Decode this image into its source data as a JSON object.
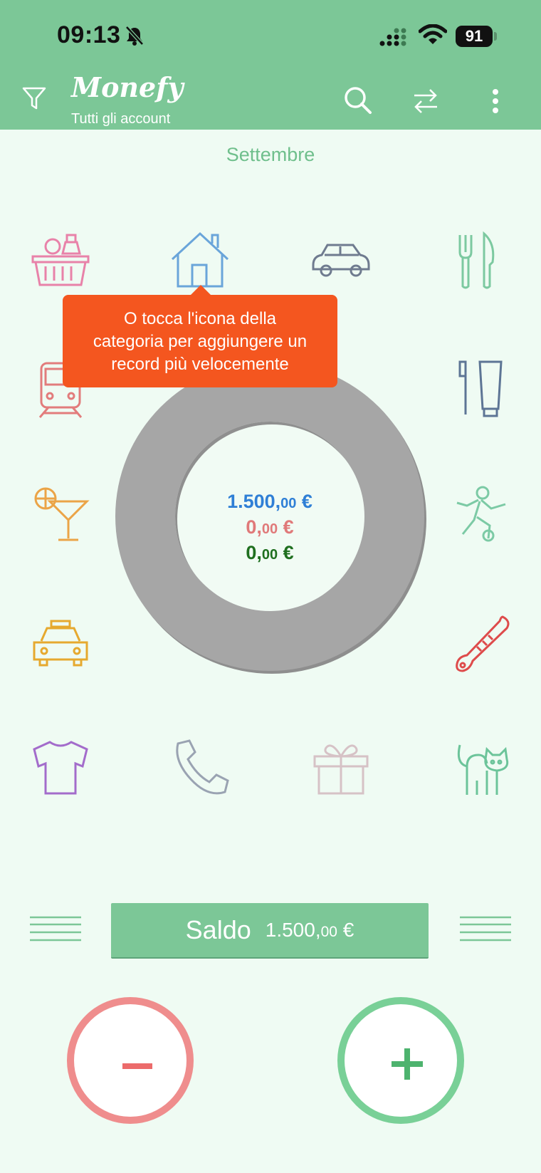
{
  "status_bar": {
    "time": "09:13",
    "battery": "91"
  },
  "header": {
    "app_name": "Monefy",
    "account": "Tutti gli account",
    "icons": [
      "filter-icon",
      "search-icon",
      "transfer-icon",
      "more-icon"
    ],
    "background": "#7cc797"
  },
  "month": "Settembre",
  "categories": [
    "groceries-basket-icon",
    "house-icon",
    "car-icon",
    "cutlery-icon",
    "train-icon",
    "toothbrush-icon",
    "cocktail-icon",
    "soccer-player-icon",
    "taxi-icon",
    "thermometer-icon",
    "tshirt-icon",
    "phone-icon",
    "gift-icon",
    "cat-icon"
  ],
  "tooltip": {
    "line1": "O tocca l'icona della",
    "line2": "categoria per aggiungere un",
    "line3": "record più velocemente"
  },
  "donut": {
    "balance_int": "1.500,",
    "balance_dec": "00",
    "expense_int": "0,",
    "expense_dec": "00",
    "income_int": "0,",
    "income_dec": "00",
    "currency": "€"
  },
  "balance_bar": {
    "label": "Saldo",
    "amount_int": "1.500,",
    "amount_dec": "00",
    "currency": "€"
  },
  "buttons": {
    "expense": "−",
    "income": "+"
  },
  "colors": {
    "expense": "#ef8d8d",
    "income": "#79d097",
    "tooltip": "#f4561f",
    "balance_text": "#2f7fd6"
  }
}
